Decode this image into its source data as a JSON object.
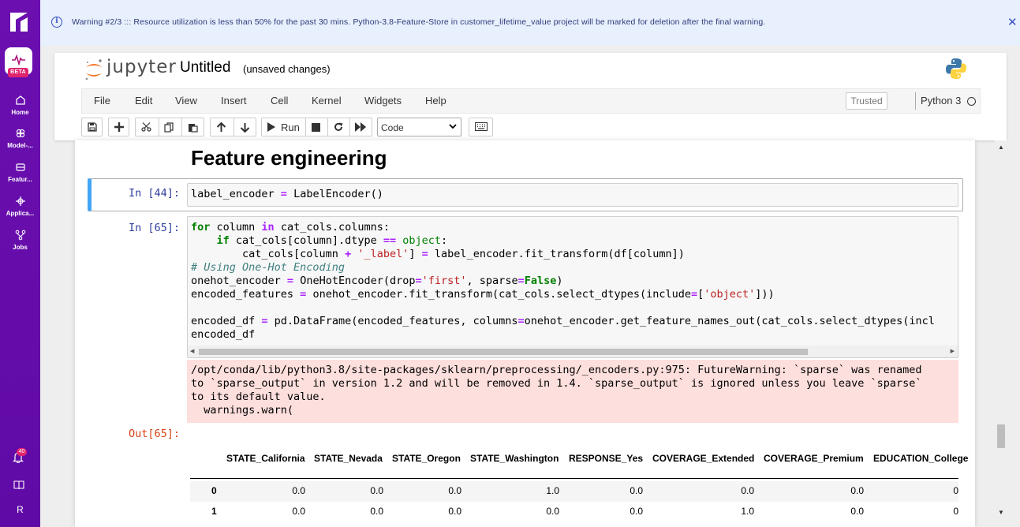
{
  "rail": {
    "beta_label": "BETA",
    "nav": [
      {
        "label": "Home",
        "icon": "home-icon"
      },
      {
        "label": "Model-...",
        "icon": "model-registry-icon"
      },
      {
        "label": "Featur...",
        "icon": "feature-store-icon"
      },
      {
        "label": "Applica...",
        "icon": "applications-icon"
      },
      {
        "label": "Jobs",
        "icon": "jobs-icon"
      }
    ],
    "notification_count": "40",
    "user_initial": "R"
  },
  "banner": {
    "message": "Warning #2/3 ::: Resource utilization is less than 50% for the past 30 mins. Python-3.8-Feature-Store in customer_lifetime_value project will be marked for deletion after the final warning.",
    "close_icon": "close-icon"
  },
  "header": {
    "logo_text": "jupyter",
    "notebook_title": "Untitled",
    "save_status": "(unsaved changes)"
  },
  "menu": {
    "items": [
      "File",
      "Edit",
      "View",
      "Insert",
      "Cell",
      "Kernel",
      "Widgets",
      "Help"
    ],
    "trusted": "Trusted",
    "kernel": "Python 3"
  },
  "toolbar": {
    "run_label": "Run",
    "cell_type": "Code"
  },
  "notebook": {
    "heading": "Feature engineering",
    "cell1": {
      "prompt": "In [44]:"
    },
    "cell2": {
      "prompt": "In [65]:",
      "out_prompt": "Out[65]:"
    },
    "stderr": [
      "/opt/conda/lib/python3.8/site-packages/sklearn/preprocessing/_encoders.py:975: FutureWarning: `sparse` was renamed",
      "to `sparse_output` in version 1.2 and will be removed in 1.4. `sparse_output` is ignored unless you leave `sparse`",
      "to its default value.",
      "  warnings.warn("
    ],
    "dataframe": {
      "columns": [
        "STATE_California",
        "STATE_Nevada",
        "STATE_Oregon",
        "STATE_Washington",
        "RESPONSE_Yes",
        "COVERAGE_Extended",
        "COVERAGE_Premium",
        "EDUCATION_College"
      ],
      "rows": [
        {
          "index": "0",
          "values": [
            "0.0",
            "0.0",
            "0.0",
            "1.0",
            "0.0",
            "0.0",
            "0.0",
            "0"
          ]
        },
        {
          "index": "1",
          "values": [
            "0.0",
            "0.0",
            "0.0",
            "0.0",
            "0.0",
            "1.0",
            "0.0",
            "0"
          ]
        }
      ]
    }
  }
}
